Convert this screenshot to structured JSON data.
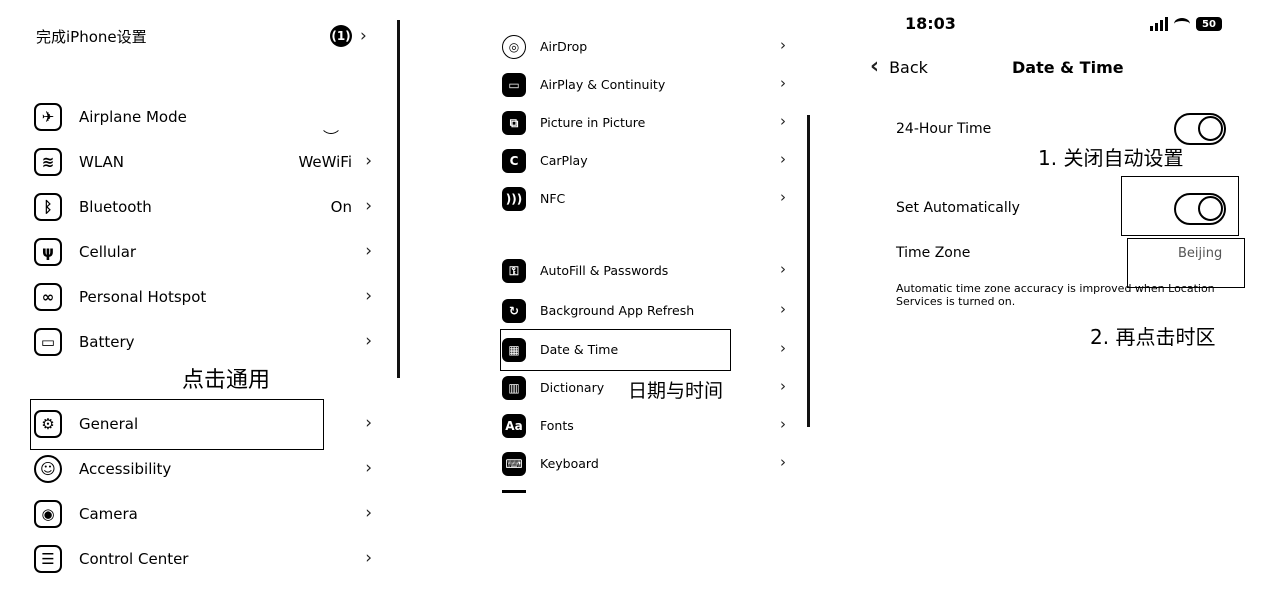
{
  "panel1": {
    "title": "完成iPhone设置",
    "badge": "(1)",
    "rows": [
      {
        "label": "Airplane Mode",
        "value": "",
        "icon": "airplane-icon"
      },
      {
        "label": "WLAN",
        "value": "WeWiFi",
        "icon": "wifi-icon"
      },
      {
        "label": "Bluetooth",
        "value": "On",
        "icon": "bluetooth-icon"
      },
      {
        "label": "Cellular",
        "value": "",
        "icon": "antenna-icon"
      },
      {
        "label": "Personal Hotspot",
        "value": "",
        "icon": "link-icon"
      },
      {
        "label": "Battery",
        "value": "",
        "icon": "battery-icon"
      },
      {
        "label": "General",
        "value": "",
        "icon": "gear-icon"
      },
      {
        "label": "Accessibility",
        "value": "",
        "icon": "person-icon"
      },
      {
        "label": "Camera",
        "value": "",
        "icon": "camera-icon"
      },
      {
        "label": "Control Center",
        "value": "",
        "icon": "switches-icon"
      }
    ],
    "annotation": "点击通用"
  },
  "panel2": {
    "rows": [
      {
        "label": "AirDrop",
        "icon": "airdrop-icon"
      },
      {
        "label": "AirPlay & Continuity",
        "icon": "airplay-icon"
      },
      {
        "label": "Picture in Picture",
        "icon": "pip-icon"
      },
      {
        "label": "CarPlay",
        "icon": "carplay-icon"
      },
      {
        "label": "NFC",
        "icon": "nfc-icon"
      },
      {
        "label": "AutoFill & Passwords",
        "icon": "key-icon"
      },
      {
        "label": "Background App Refresh",
        "icon": "refresh-icon"
      },
      {
        "label": "Date & Time",
        "icon": "calendar-clock-icon"
      },
      {
        "label": "Dictionary",
        "icon": "book-icon"
      },
      {
        "label": "Fonts",
        "icon": "fonts-icon"
      },
      {
        "label": "Keyboard",
        "icon": "keyboard-icon"
      }
    ],
    "annotation": "日期与时间"
  },
  "panel3": {
    "status_time": "18:03",
    "battery": "50",
    "back_label": "Back",
    "nav_title": "Date & Time",
    "hour24_label": "24-Hour Time",
    "hour24_on": false,
    "set_auto_label": "Set Automatically",
    "set_auto_on": false,
    "timezone_label": "Time Zone",
    "timezone_value": "Beijing",
    "footer": "Automatic time zone accuracy is improved when Location Services is turned on.",
    "annotation1": "1. 关闭自动设置",
    "annotation2": "2. 再点击时区"
  }
}
